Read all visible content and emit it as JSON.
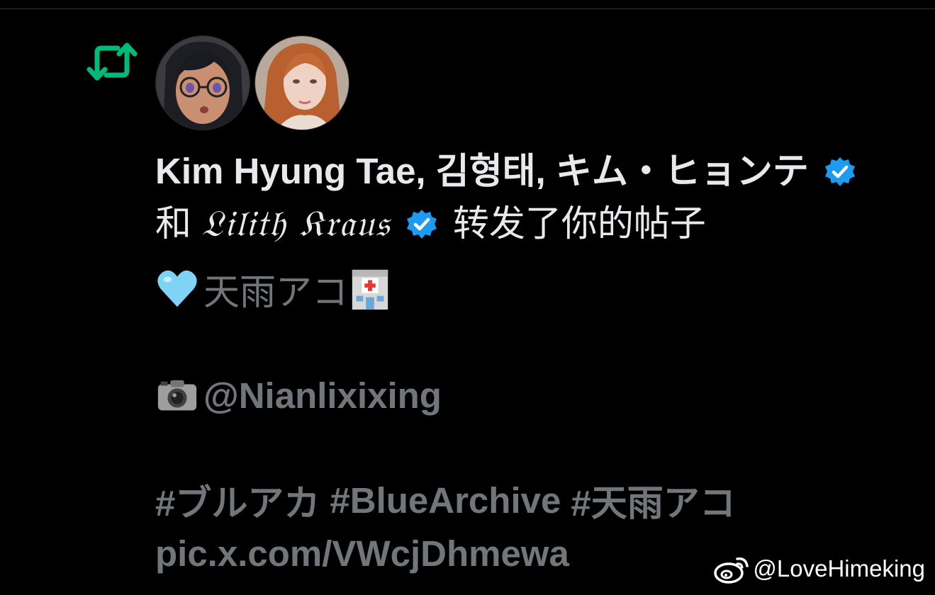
{
  "notification": {
    "user1": "Kim Hyung Tae, 김형태, キム・ヒョンテ",
    "connector": "和",
    "user2": "𝔏𝔦𝔩𝔦𝔱𝔥 𝔎𝔯𝔞𝔲𝔰",
    "action": "转发了你的帖子"
  },
  "post": {
    "line1_text": "天雨アコ",
    "mention": "@Nianlixixing",
    "hashtags": [
      "#ブルアカ",
      "#BlueArchive",
      "#天雨アコ"
    ],
    "link": "pic.x.com/VWcjDhmewa"
  },
  "watermark": {
    "handle": "@LoveHimeking"
  },
  "icons": {
    "repost": "repost-icon",
    "verified": "verified-badge-icon",
    "heart": "light-blue-heart-emoji",
    "hospital": "hospital-emoji",
    "camera": "camera-emoji",
    "weibo": "weibo-logo-icon"
  },
  "colors": {
    "background": "#000000",
    "repost_green": "#00ba7c",
    "verified_blue": "#1d9bf0",
    "primary_text": "#e7e9ea",
    "secondary_text": "#71767b"
  }
}
